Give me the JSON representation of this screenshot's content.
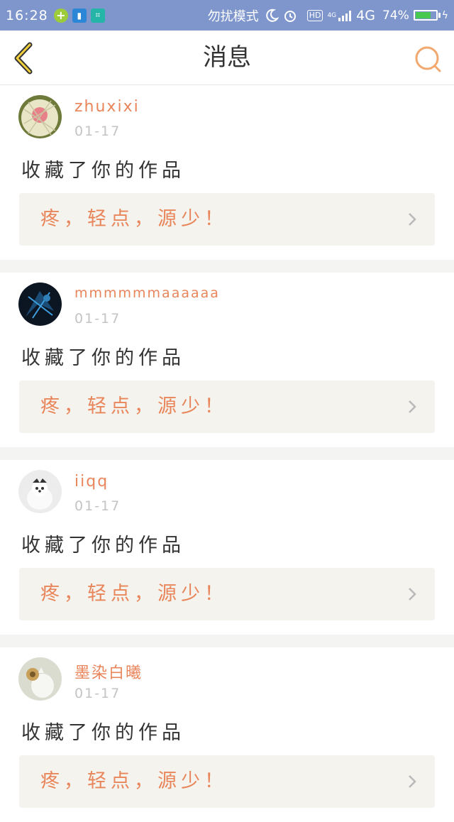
{
  "status_bar": {
    "time": "16:28",
    "mode_text": "勿扰模式",
    "hd": "HD",
    "network_small": "4G",
    "network": "4G",
    "battery": "74%",
    "battery_level": 0.74,
    "battery_color": "#46c94e",
    "icons": [
      "plus-badge-icon",
      "battery-saver-icon",
      "scan-icon",
      "moon-icon",
      "alarm-icon",
      "signal-icon"
    ]
  },
  "header": {
    "title": "消息",
    "back_icon": "back-chevron-icon",
    "search_icon": "search-icon",
    "accent_color": "#e9855a"
  },
  "messages": [
    {
      "username": "zhuxixi",
      "date": "01-17",
      "action": "收藏了你的作品",
      "work_title": "疼，轻点，源少！",
      "avatar": "melon-avatar"
    },
    {
      "username": "mmmmmmaaaaaa",
      "date": "01-17",
      "action": "收藏了你的作品",
      "work_title": "疼，轻点，源少！",
      "avatar": "dark-blue-avatar"
    },
    {
      "username": "iiqq",
      "date": "01-17",
      "action": "收藏了你的作品",
      "work_title": "疼，轻点，源少！",
      "avatar": "dog-avatar"
    },
    {
      "username": "墨染白曦",
      "date": "01-17",
      "action": "收藏了你的作品",
      "work_title": "疼，轻点，源少！",
      "avatar": "cat-avatar"
    }
  ]
}
